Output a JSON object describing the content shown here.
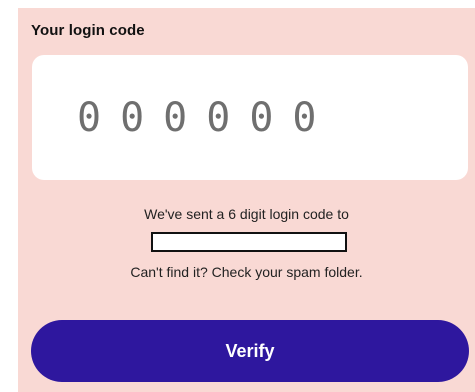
{
  "login": {
    "heading": "Your login code",
    "code_placeholder": "000000",
    "sent_message": "We've sent a 6 digit login code to",
    "spam_message": "Can't find it? Check your spam folder.",
    "verify_label": "Verify"
  },
  "colors": {
    "panel_background": "#f9d9d4",
    "button_background": "#2e179e",
    "button_text": "#ffffff",
    "code_digits": "#6f6f6f"
  }
}
